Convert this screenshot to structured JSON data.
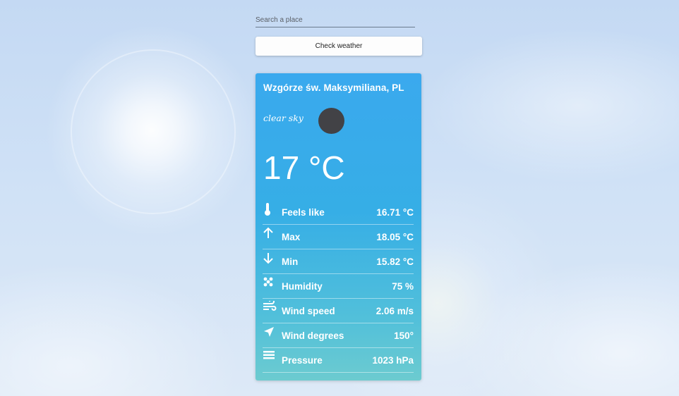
{
  "search": {
    "placeholder": "Search a place",
    "value": ""
  },
  "check_button": {
    "label": "Check weather"
  },
  "card": {
    "location": "Wzgórze św. Maksymiliana, PL",
    "description": "clear sky",
    "temperature": "17 °C",
    "details": [
      {
        "icon": "thermometer-icon",
        "label": "Feels like",
        "value": "16.71 °C"
      },
      {
        "icon": "arrow-up-icon",
        "label": "Max",
        "value": "18.05 °C"
      },
      {
        "icon": "arrow-down-icon",
        "label": "Min",
        "value": "15.82 °C"
      },
      {
        "icon": "humidity-icon",
        "label": "Humidity",
        "value": "75 %"
      },
      {
        "icon": "wind-icon",
        "label": "Wind speed",
        "value": "2.06 m/s"
      },
      {
        "icon": "navigation-icon",
        "label": "Wind degrees",
        "value": "150°"
      },
      {
        "icon": "pressure-icon",
        "label": "Pressure",
        "value": "1023 hPa"
      }
    ]
  },
  "colors": {
    "card_top": "#3aa9ee",
    "card_bottom": "#6ccbd0",
    "weather_icon": "#424246"
  }
}
